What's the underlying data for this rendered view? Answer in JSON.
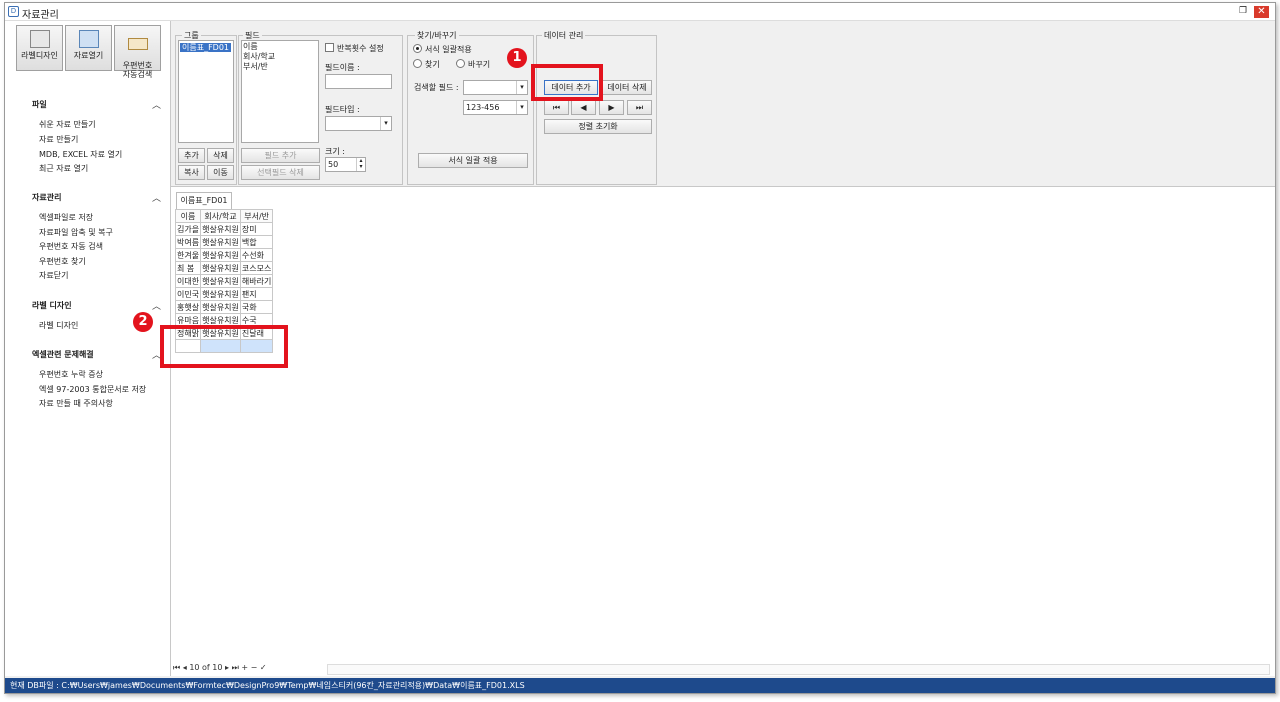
{
  "window": {
    "title": "자료관리"
  },
  "sidebar": {
    "buttons": [
      "라벨디자인",
      "자료열기",
      "우편번호\n자동검색"
    ],
    "sections": [
      {
        "title": "파일",
        "items": [
          "쉬운 자료 만들기",
          "자료 만들기",
          "MDB, EXCEL 자료 열기",
          "최근 자료 열기"
        ]
      },
      {
        "title": "자료관리",
        "items": [
          "엑셀파일로 저장",
          "자료파일 압축 및 복구",
          "우편번호 자동 검색",
          "우편번호 찾기",
          "자료닫기"
        ]
      },
      {
        "title": "라벨 디자인",
        "items": [
          "라벨 디자인"
        ]
      },
      {
        "title": "엑셀관련 문제해결",
        "items": [
          "우편번호 누락 증상",
          "엑셀 97-2003 통합문서로 저장",
          "자료 만들 때 주의사항"
        ]
      }
    ]
  },
  "group": {
    "label": "그룹",
    "items": [
      "이름표_FD01"
    ],
    "add": "추가",
    "delete": "삭제",
    "copy": "복사",
    "move": "이동"
  },
  "field": {
    "label": "필드",
    "items": [
      "이름",
      "회사/학교",
      "부서/반"
    ],
    "repeat_label": "반복횟수 설정",
    "name_label": "필드이름 :",
    "type_label": "필드타입 :",
    "size_label": "크기 :",
    "size_value": "50",
    "add_button": "필드 추가",
    "delete_button": "선택필드 삭제"
  },
  "find": {
    "label": "찾기/바꾸기",
    "opt_format": "서식 일괄적용",
    "opt_find": "찾기",
    "opt_replace": "바꾸기",
    "search_field_label": "검색할 필드 :",
    "format_value": "123-456",
    "apply_button": "서식 일괄 적용"
  },
  "data_mgmt": {
    "label": "데이터 관리",
    "add_button": "데이터 추가",
    "delete_button": "데이터 삭제",
    "reset_button": "정렬 초기화"
  },
  "annotations": {
    "one": "1",
    "two": "2"
  },
  "table": {
    "tab": "이름표_FD01",
    "headers": [
      "이름",
      "회사/학교",
      "부서/반"
    ],
    "rows": [
      [
        "김가을",
        "햇살유치원",
        "장미"
      ],
      [
        "박여름",
        "햇살유치원",
        "백합"
      ],
      [
        "한겨울",
        "햇살유치원",
        "수선화"
      ],
      [
        "최 봄",
        "햇살유치원",
        "코스모스"
      ],
      [
        "이대한",
        "햇살유치원",
        "해바라기"
      ],
      [
        "이민국",
        "햇살유치원",
        "팬지"
      ],
      [
        "홍햇살",
        "햇살유치원",
        "국화"
      ],
      [
        "유마음",
        "햇살유치원",
        "수국"
      ],
      [
        "정해맑",
        "햇살유치원",
        "진달래"
      ]
    ]
  },
  "navigator": {
    "text": "10 of 10"
  },
  "status": {
    "text": "현재 DB파일 : C:₩Users₩james₩Documents₩Formtec₩DesignPro9₩Temp₩네임스티커(96칸_자료관리적용)₩Data₩이름표_FD01.XLS"
  }
}
